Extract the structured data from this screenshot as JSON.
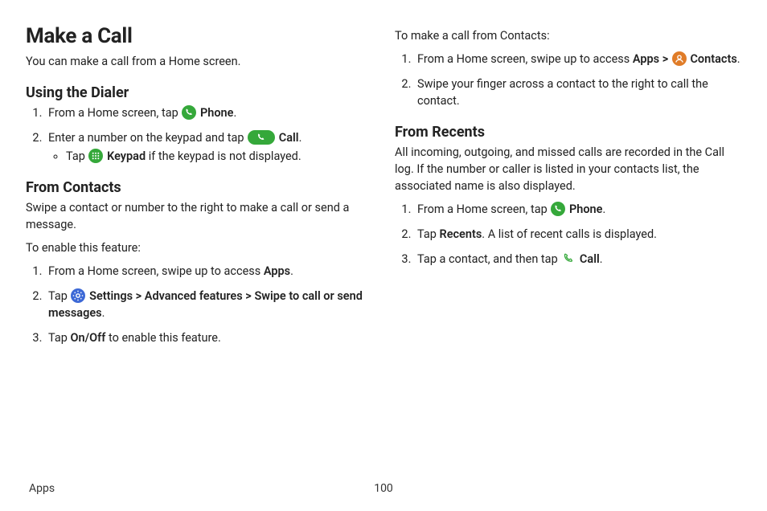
{
  "left": {
    "title": "Make a Call",
    "intro": "You can make a call from a Home screen.",
    "dialer": {
      "heading": "Using the Dialer",
      "step1_a": "From a Home screen, tap ",
      "step1_phone": " Phone",
      "step1_b": ".",
      "step2_a": "Enter a number on the keypad and tap ",
      "step2_call": " Call",
      "step2_b": ".",
      "sub_a": "Tap ",
      "sub_keypad": " Keypad",
      "sub_b": " if the keypad is not displayed."
    },
    "contacts": {
      "heading": "From Contacts",
      "intro": "Swipe a contact or number to the right to make a call or send a message.",
      "enable": "To enable this feature:",
      "step1_a": "From a Home screen, swipe up to access ",
      "step1_apps": "Apps",
      "step1_b": ".",
      "step2_a": "Tap ",
      "step2_settings": " Settings",
      "step2_arrow1": " > ",
      "step2_adv": "Advanced features",
      "step2_arrow2": " > ",
      "step2_swipe": "Swipe to call or send messages",
      "step2_b": ".",
      "step3_a": "Tap ",
      "step3_onoff": "On/Off",
      "step3_b": " to enable this feature."
    }
  },
  "right": {
    "lead": "To make a call from Contacts:",
    "step1_a": "From a Home screen, swipe up to access ",
    "step1_apps": "Apps",
    "step1_arrow": " > ",
    "step1_contacts": " Contacts",
    "step1_b": ".",
    "step2": "Swipe your finger across a contact to the right to call the contact.",
    "recents": {
      "heading": "From Recents",
      "intro": "All incoming, outgoing, and missed calls are recorded in the Call log. If the number or caller is listed in your contacts list, the associated name is also displayed.",
      "step1_a": "From a Home screen, tap ",
      "step1_phone": " Phone",
      "step1_b": ".",
      "step2_a": "Tap ",
      "step2_recents": "Recents",
      "step2_b": ". A list of recent calls is displayed.",
      "step3_a": "Tap a contact, and then tap ",
      "step3_call": " Call",
      "step3_b": "."
    }
  },
  "footer": {
    "section": "Apps",
    "page": "100"
  },
  "icon_colors": {
    "green_bg": "#35a83a",
    "orange_bg": "#e07c28",
    "blue_bg": "#3c68d6",
    "white": "#ffffff"
  }
}
